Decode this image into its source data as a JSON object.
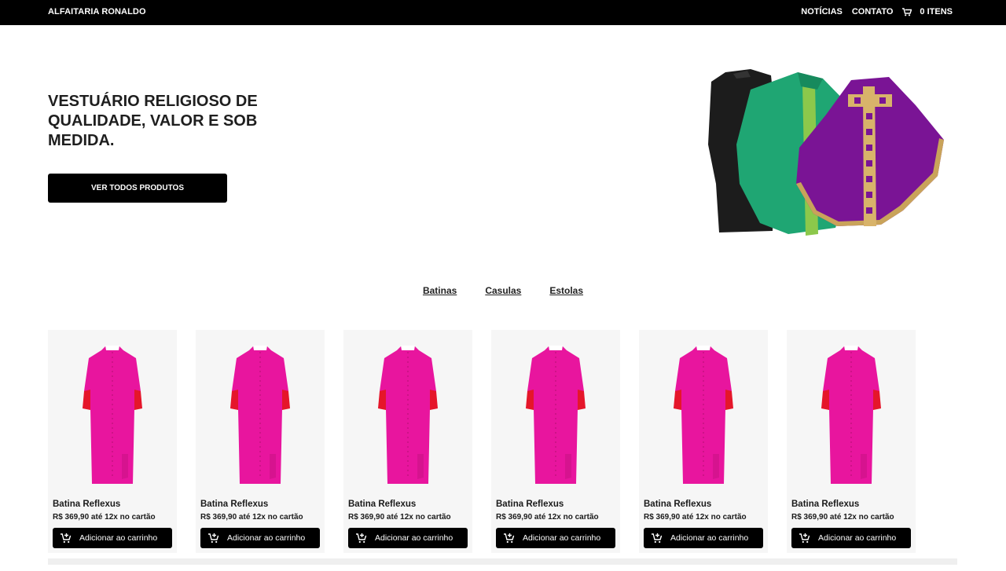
{
  "header": {
    "brand": "ALFAITARIA RONALDO",
    "nav": [
      "NOTÍCIAS",
      "CONTATO"
    ],
    "cart_label": "0 ITENS"
  },
  "hero": {
    "title": "VESTUÁRIO RELIGIOSO DE QUALIDADE, VALOR E SOB MEDIDA.",
    "cta": "VER TODOS PRODUTOS"
  },
  "categories": [
    "Batinas",
    "Casulas",
    "Estolas"
  ],
  "products": [
    {
      "name": "Batina Reflexus",
      "price": "R$ 369,90 até 12x no cartão",
      "button": "Adicionar ao carrinho"
    },
    {
      "name": "Batina Reflexus",
      "price": "R$ 369,90 até 12x no cartão",
      "button": "Adicionar ao carrinho"
    },
    {
      "name": "Batina Reflexus",
      "price": "R$ 369,90 até 12x no cartão",
      "button": "Adicionar ao carrinho"
    },
    {
      "name": "Batina Reflexus",
      "price": "R$ 369,90 até 12x no cartão",
      "button": "Adicionar ao carrinho"
    },
    {
      "name": "Batina Reflexus",
      "price": "R$ 369,90 até 12x no cartão",
      "button": "Adicionar ao carrinho"
    },
    {
      "name": "Batina Reflexus",
      "price": "R$ 369,90 até 12x no cartão",
      "button": "Adicionar ao carrinho"
    }
  ],
  "icons": {
    "cart": "cart-icon",
    "add_to_cart": "add-cart-icon"
  },
  "colors": {
    "topbar": "#000000",
    "dress": "#e8159e",
    "cuffs": "#e5162a",
    "card_bg": "#f6f6f6"
  }
}
